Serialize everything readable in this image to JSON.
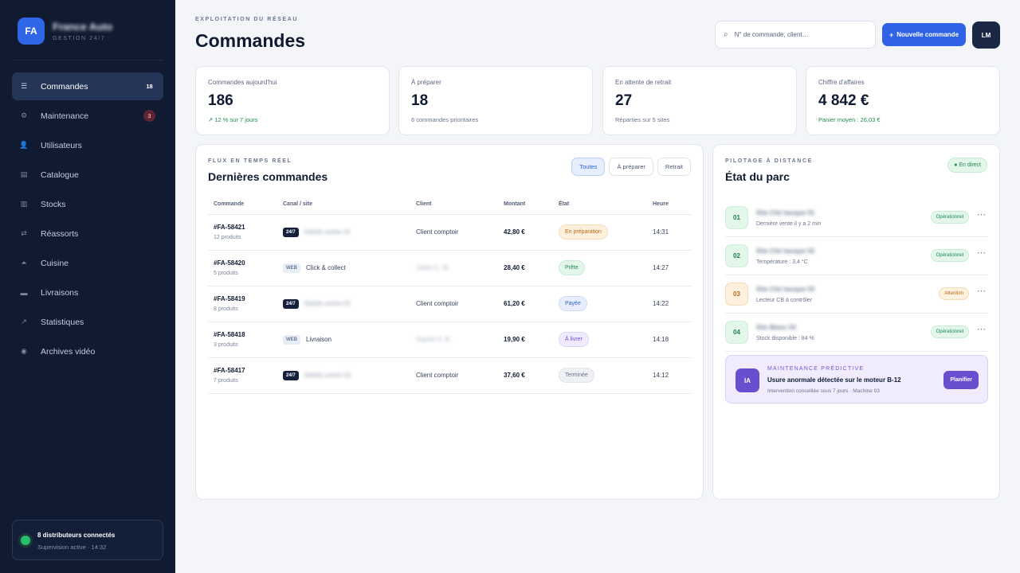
{
  "brand": {
    "logo": "FA",
    "name": "France Auto",
    "subtitle": "GESTION 24/7"
  },
  "nav": [
    {
      "label": "Commandes",
      "icon": "list-icon",
      "glyph": "☰",
      "badge": "18",
      "active": true
    },
    {
      "label": "Maintenance",
      "icon": "gear-icon",
      "glyph": "⚙",
      "badge": "3",
      "badge_color": "red"
    },
    {
      "label": "Utilisateurs",
      "icon": "user-icon",
      "glyph": "👤"
    },
    {
      "label": "Catalogue",
      "icon": "catalog-icon",
      "glyph": "▤"
    },
    {
      "label": "Stocks",
      "icon": "stock-icon",
      "glyph": "▥"
    },
    {
      "label": "Réassorts",
      "icon": "swap-icon",
      "glyph": "⇄"
    },
    {
      "label": "Cuisine",
      "icon": "kitchen-icon",
      "glyph": "⏶"
    },
    {
      "label": "Livraisons",
      "icon": "truck-icon",
      "glyph": "▬"
    },
    {
      "label": "Statistiques",
      "icon": "chart-icon",
      "glyph": "↗"
    },
    {
      "label": "Archives vidéo",
      "icon": "video-icon",
      "glyph": "◉"
    }
  ],
  "connection": {
    "title": "8 distributeurs connectés",
    "subtitle": "Supervision active · 14:32"
  },
  "header": {
    "eyebrow": "EXPLOITATION DU RÉSEAU",
    "title": "Commandes",
    "search_placeholder": "N° de commande, client…",
    "new_button": "Nouvelle commande",
    "avatar": "LM"
  },
  "stats": [
    {
      "label": "Commandes aujourd'hui",
      "value": "186",
      "sub": "↗ 12 % sur 7 jours",
      "sub_color": "green"
    },
    {
      "label": "À préparer",
      "value": "18",
      "sub": "6 commandes prioritaires"
    },
    {
      "label": "En attente de retrait",
      "value": "27",
      "sub": "Réparties sur 5 sites"
    },
    {
      "label": "Chiffre d'affaires",
      "value": "4 842 €",
      "sub": "Panier moyen : 26,03 €",
      "sub_color": "green"
    }
  ],
  "orders": {
    "eyebrow": "FLUX EN TEMPS RÉEL",
    "title": "Dernières commandes",
    "filters": [
      "Toutes",
      "À préparer",
      "Retrait"
    ],
    "columns": [
      "Commande",
      "Canal / site",
      "Client",
      "Montant",
      "État",
      "Heure"
    ],
    "rows": [
      {
        "id": "#FA-58421",
        "items": "12 produits",
        "chip": "24/7",
        "site": "Distrib centre 01",
        "client": "Client comptoir",
        "amount": "42,80 €",
        "status": "En préparation",
        "status_color": "orange",
        "time": "14:31"
      },
      {
        "id": "#FA-58420",
        "items": "5 produits",
        "chip": "WEB",
        "site": "Click & collect",
        "client": "Julien C. M.",
        "amount": "28,40 €",
        "status": "Prête",
        "status_color": "green",
        "time": "14:27"
      },
      {
        "id": "#FA-58419",
        "items": "8 produits",
        "chip": "24/7",
        "site": "Distrib centre 02",
        "client": "Client comptoir",
        "amount": "61,20 €",
        "status": "Payée",
        "status_color": "blue",
        "time": "14:22"
      },
      {
        "id": "#FA-58418",
        "items": "3 produits",
        "chip": "WEB",
        "site": "Livraison",
        "client": "Sophie A. B.",
        "amount": "19,90 €",
        "status": "À livrer",
        "status_color": "purple",
        "time": "14:18"
      },
      {
        "id": "#FA-58417",
        "items": "7 produits",
        "chip": "24/7",
        "site": "Distrib centre 03",
        "client": "Client comptoir",
        "amount": "37,60 €",
        "status": "Terminée",
        "status_color": "gray",
        "time": "14:12"
      }
    ]
  },
  "fleet": {
    "eyebrow": "PILOTAGE À DISTANCE",
    "title": "État du parc",
    "live": "● En direct",
    "machines": [
      {
        "num": "01",
        "name": "Site Cité basque 01",
        "detail": "Dernière vente il y a 2 min",
        "status": "Opérationnel",
        "state": "ok"
      },
      {
        "num": "02",
        "name": "Site Cité basque 02",
        "detail": "Température : 3,4 °C",
        "status": "Opérationnel",
        "state": "ok"
      },
      {
        "num": "03",
        "name": "Site Cité basque 03",
        "detail": "Lecteur CB à contrôler",
        "status": "Attention",
        "state": "warn"
      },
      {
        "num": "04",
        "name": "Site Blanc 04",
        "detail": "Stock disponible : 84 %",
        "status": "Opérationnel",
        "state": "ok"
      }
    ],
    "ai": {
      "badge": "IA",
      "eyebrow": "MAINTENANCE PRÉDICTIVE",
      "title": "Usure anormale détectée sur le moteur B-12",
      "subtitle": "Intervention conseillée sous 7 jours · Machine 03",
      "button": "Planifier"
    }
  }
}
